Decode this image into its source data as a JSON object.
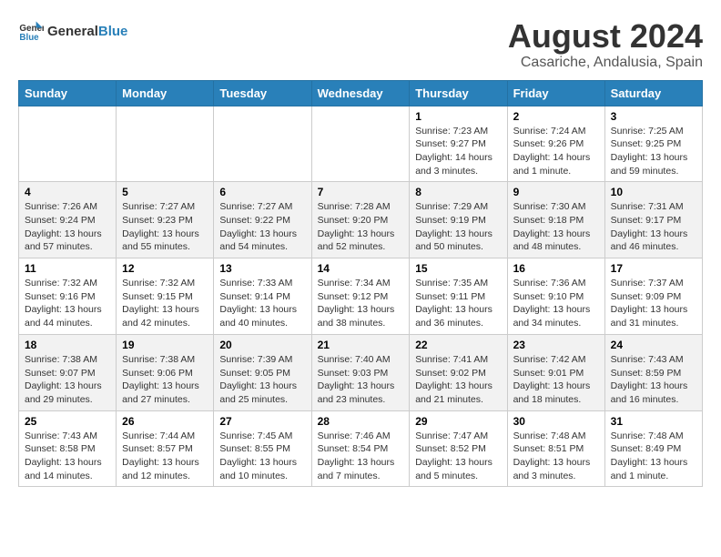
{
  "header": {
    "logo_general": "General",
    "logo_blue": "Blue",
    "main_title": "August 2024",
    "subtitle": "Casariche, Andalusia, Spain"
  },
  "days_of_week": [
    "Sunday",
    "Monday",
    "Tuesday",
    "Wednesday",
    "Thursday",
    "Friday",
    "Saturday"
  ],
  "weeks": [
    [
      {
        "day": "",
        "info": ""
      },
      {
        "day": "",
        "info": ""
      },
      {
        "day": "",
        "info": ""
      },
      {
        "day": "",
        "info": ""
      },
      {
        "day": "1",
        "info": "Sunrise: 7:23 AM\nSunset: 9:27 PM\nDaylight: 14 hours\nand 3 minutes."
      },
      {
        "day": "2",
        "info": "Sunrise: 7:24 AM\nSunset: 9:26 PM\nDaylight: 14 hours\nand 1 minute."
      },
      {
        "day": "3",
        "info": "Sunrise: 7:25 AM\nSunset: 9:25 PM\nDaylight: 13 hours\nand 59 minutes."
      }
    ],
    [
      {
        "day": "4",
        "info": "Sunrise: 7:26 AM\nSunset: 9:24 PM\nDaylight: 13 hours\nand 57 minutes."
      },
      {
        "day": "5",
        "info": "Sunrise: 7:27 AM\nSunset: 9:23 PM\nDaylight: 13 hours\nand 55 minutes."
      },
      {
        "day": "6",
        "info": "Sunrise: 7:27 AM\nSunset: 9:22 PM\nDaylight: 13 hours\nand 54 minutes."
      },
      {
        "day": "7",
        "info": "Sunrise: 7:28 AM\nSunset: 9:20 PM\nDaylight: 13 hours\nand 52 minutes."
      },
      {
        "day": "8",
        "info": "Sunrise: 7:29 AM\nSunset: 9:19 PM\nDaylight: 13 hours\nand 50 minutes."
      },
      {
        "day": "9",
        "info": "Sunrise: 7:30 AM\nSunset: 9:18 PM\nDaylight: 13 hours\nand 48 minutes."
      },
      {
        "day": "10",
        "info": "Sunrise: 7:31 AM\nSunset: 9:17 PM\nDaylight: 13 hours\nand 46 minutes."
      }
    ],
    [
      {
        "day": "11",
        "info": "Sunrise: 7:32 AM\nSunset: 9:16 PM\nDaylight: 13 hours\nand 44 minutes."
      },
      {
        "day": "12",
        "info": "Sunrise: 7:32 AM\nSunset: 9:15 PM\nDaylight: 13 hours\nand 42 minutes."
      },
      {
        "day": "13",
        "info": "Sunrise: 7:33 AM\nSunset: 9:14 PM\nDaylight: 13 hours\nand 40 minutes."
      },
      {
        "day": "14",
        "info": "Sunrise: 7:34 AM\nSunset: 9:12 PM\nDaylight: 13 hours\nand 38 minutes."
      },
      {
        "day": "15",
        "info": "Sunrise: 7:35 AM\nSunset: 9:11 PM\nDaylight: 13 hours\nand 36 minutes."
      },
      {
        "day": "16",
        "info": "Sunrise: 7:36 AM\nSunset: 9:10 PM\nDaylight: 13 hours\nand 34 minutes."
      },
      {
        "day": "17",
        "info": "Sunrise: 7:37 AM\nSunset: 9:09 PM\nDaylight: 13 hours\nand 31 minutes."
      }
    ],
    [
      {
        "day": "18",
        "info": "Sunrise: 7:38 AM\nSunset: 9:07 PM\nDaylight: 13 hours\nand 29 minutes."
      },
      {
        "day": "19",
        "info": "Sunrise: 7:38 AM\nSunset: 9:06 PM\nDaylight: 13 hours\nand 27 minutes."
      },
      {
        "day": "20",
        "info": "Sunrise: 7:39 AM\nSunset: 9:05 PM\nDaylight: 13 hours\nand 25 minutes."
      },
      {
        "day": "21",
        "info": "Sunrise: 7:40 AM\nSunset: 9:03 PM\nDaylight: 13 hours\nand 23 minutes."
      },
      {
        "day": "22",
        "info": "Sunrise: 7:41 AM\nSunset: 9:02 PM\nDaylight: 13 hours\nand 21 minutes."
      },
      {
        "day": "23",
        "info": "Sunrise: 7:42 AM\nSunset: 9:01 PM\nDaylight: 13 hours\nand 18 minutes."
      },
      {
        "day": "24",
        "info": "Sunrise: 7:43 AM\nSunset: 8:59 PM\nDaylight: 13 hours\nand 16 minutes."
      }
    ],
    [
      {
        "day": "25",
        "info": "Sunrise: 7:43 AM\nSunset: 8:58 PM\nDaylight: 13 hours\nand 14 minutes."
      },
      {
        "day": "26",
        "info": "Sunrise: 7:44 AM\nSunset: 8:57 PM\nDaylight: 13 hours\nand 12 minutes."
      },
      {
        "day": "27",
        "info": "Sunrise: 7:45 AM\nSunset: 8:55 PM\nDaylight: 13 hours\nand 10 minutes."
      },
      {
        "day": "28",
        "info": "Sunrise: 7:46 AM\nSunset: 8:54 PM\nDaylight: 13 hours\nand 7 minutes."
      },
      {
        "day": "29",
        "info": "Sunrise: 7:47 AM\nSunset: 8:52 PM\nDaylight: 13 hours\nand 5 minutes."
      },
      {
        "day": "30",
        "info": "Sunrise: 7:48 AM\nSunset: 8:51 PM\nDaylight: 13 hours\nand 3 minutes."
      },
      {
        "day": "31",
        "info": "Sunrise: 7:48 AM\nSunset: 8:49 PM\nDaylight: 13 hours\nand 1 minute."
      }
    ]
  ]
}
